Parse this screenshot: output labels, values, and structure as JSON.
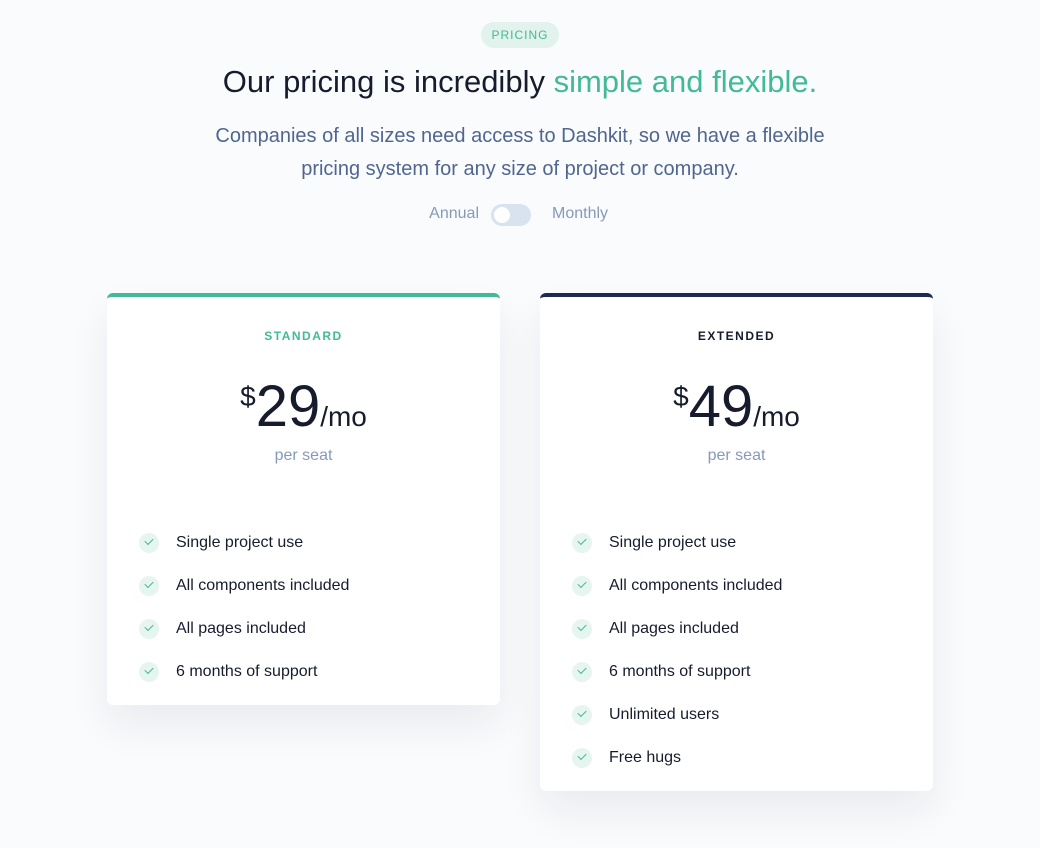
{
  "badge": "PRICING",
  "title": {
    "main": "Our pricing is incredibly ",
    "accent": "simple and flexible."
  },
  "subtitle": "Companies of all sizes need access to Dashkit, so we have a flexible pricing system for any size of project or company.",
  "billing": {
    "annual_label": "Annual",
    "monthly_label": "Monthly",
    "monthly_selected": false
  },
  "colors": {
    "accent": "#42ba96",
    "dark": "#1b2a4e",
    "muted": "#869ab8",
    "background": "#f9fbfd"
  },
  "plans": [
    {
      "name": "STANDARD",
      "currency": "$",
      "amount": "29",
      "period": "/mo",
      "unit": "per seat",
      "features": [
        "Single project use",
        "All components included",
        "All pages included",
        "6 months of support"
      ]
    },
    {
      "name": "EXTENDED",
      "currency": "$",
      "amount": "49",
      "period": "/mo",
      "unit": "per seat",
      "features": [
        "Single project use",
        "All components included",
        "All pages included",
        "6 months of support",
        "Unlimited users",
        "Free hugs"
      ]
    }
  ]
}
